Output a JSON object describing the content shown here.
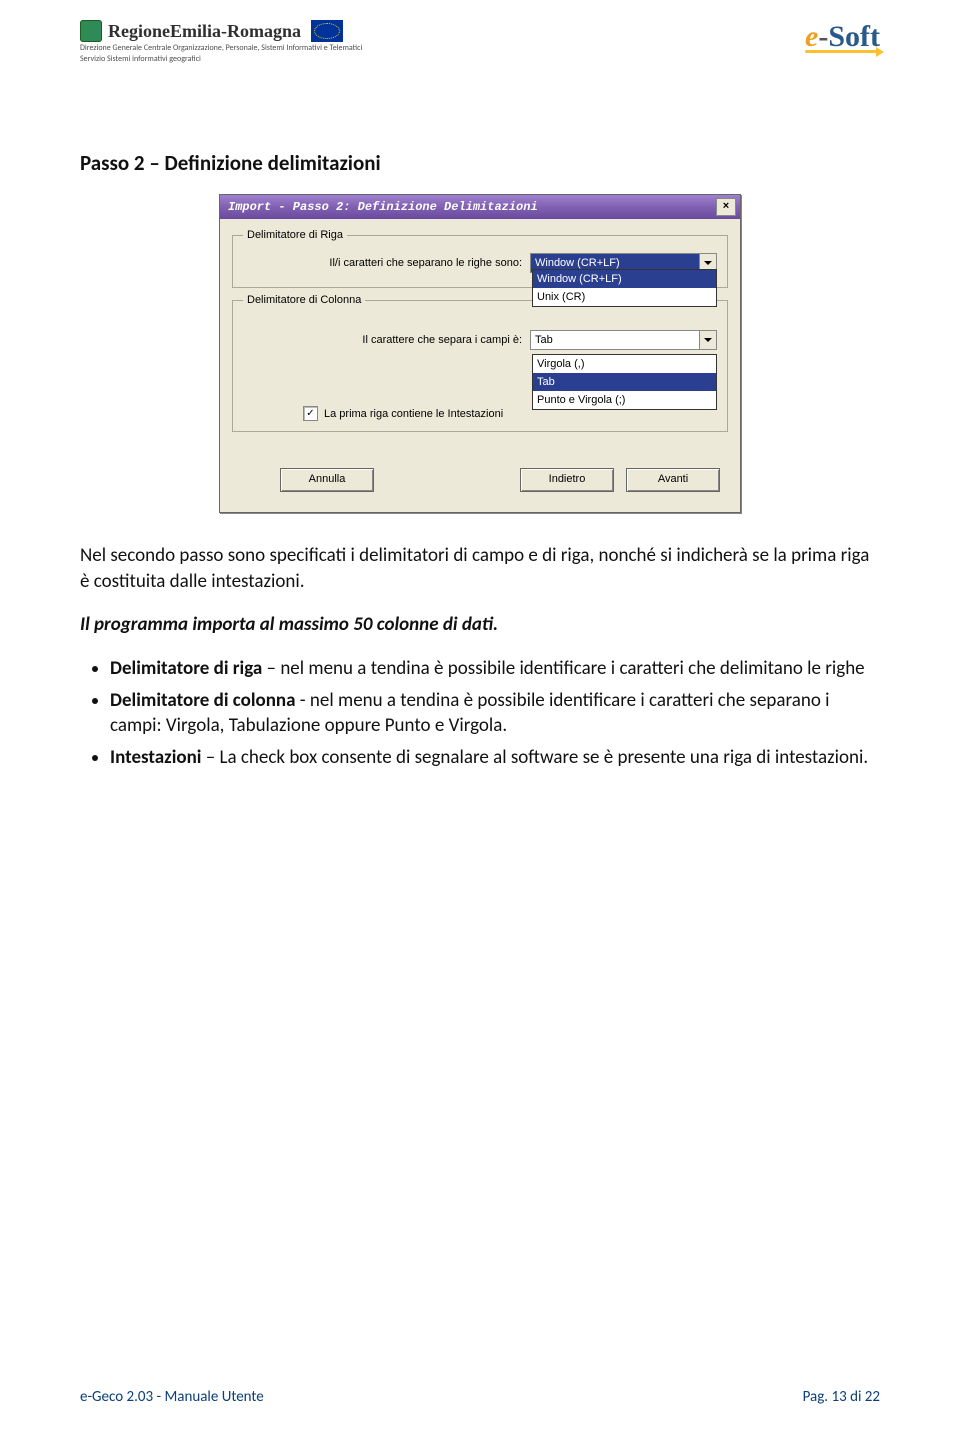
{
  "header": {
    "region_name": "RegioneEmilia-Romagna",
    "sub1": "Direzione Generale Centrale Organizzazione, Personale, Sistemi Informativi e Telematici",
    "sub2": "Servizio Sistemi informativi geografici",
    "brand_e": "e",
    "brand_dash": "-",
    "brand_soft": "Soft"
  },
  "heading": "Passo 2 – Definizione delimitazioni",
  "dialog": {
    "title": "Import - Passo 2: Definizione Delimitazioni",
    "close": "×",
    "group1": {
      "legend": "Delimitatore di Riga",
      "label": "Il/i caratteri che separano le righe sono:",
      "value": "Window (CR+LF)",
      "options": [
        "Window (CR+LF)",
        "Unix (CR)"
      ]
    },
    "group2": {
      "legend": "Delimitatore di Colonna",
      "label": "Il carattere che separa i campi è:",
      "value": "Tab",
      "options": [
        "Virgola (,)",
        "Tab",
        "Punto e Virgola (;)"
      ]
    },
    "checkbox": {
      "checked": "✓",
      "label": "La prima riga contiene le Intestazioni"
    },
    "buttons": {
      "annulla": "Annulla",
      "indietro": "Indietro",
      "avanti": "Avanti"
    }
  },
  "para1": "Nel secondo passo sono specificati i delimitatori di campo e di riga, nonché si indicherà se la prima riga è costituita dalle intestazioni.",
  "para2": "Il programma importa al massimo 50 colonne di dati.",
  "bullets": {
    "b1a": "Delimitatore di riga",
    "b1b": " – nel menu a tendina è possibile identificare i caratteri che delimitano le righe",
    "b2a": "Delimitatore di colonna",
    "b2b": " - nel menu a tendina è possibile identificare i caratteri che separano i campi: Virgola, Tabulazione oppure Punto e Virgola.",
    "b3a": "Intestazioni",
    "b3b": " – La check box consente di segnalare al software se è presente una riga di intestazioni."
  },
  "footer": {
    "left": "e-Geco 2.03 - Manuale Utente",
    "right": "Pag. 13 di 22"
  }
}
